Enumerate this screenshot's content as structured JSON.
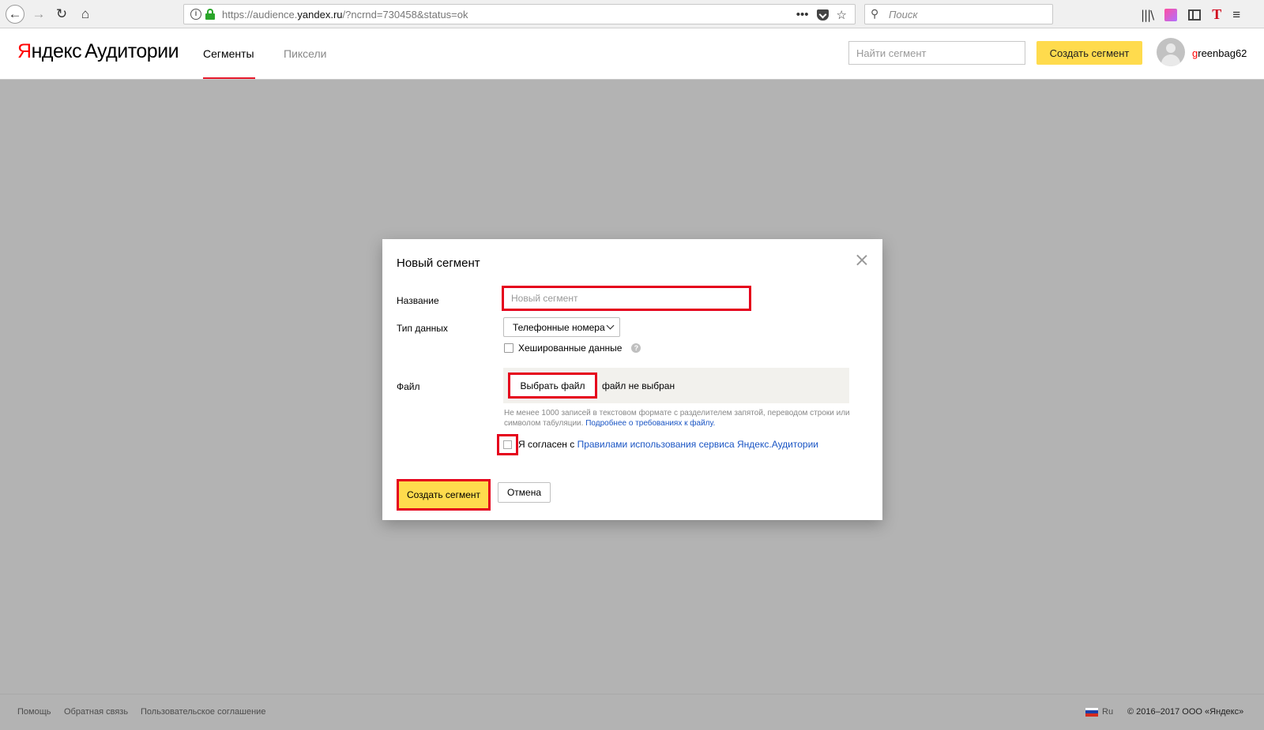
{
  "browser": {
    "url_prefix": "https://audience.",
    "url_host": "yandex.ru",
    "url_suffix": "/?ncrnd=730458&status=ok",
    "more_actions": "•••",
    "bookmark_star": "☆",
    "search_placeholder": "Поиск",
    "icons": {
      "back": "←",
      "forward": "→",
      "reload": "↻",
      "home": "⌂",
      "info": "i",
      "search": "⚲",
      "library": "|||\\",
      "t_addon": "T",
      "menu": "≡"
    }
  },
  "header": {
    "logo_y": "Я",
    "logo_rest": "ндекс",
    "logo_product": "Аудитории",
    "tabs": [
      {
        "label": "Сегменты",
        "active": true
      },
      {
        "label": "Пиксели",
        "active": false
      }
    ],
    "find_placeholder": "Найти сегмент",
    "create_button": "Создать сегмент",
    "username_first": "g",
    "username_rest": "reenbag62"
  },
  "modal": {
    "title": "Новый сегмент",
    "name_label": "Название",
    "name_placeholder": "Новый сегмент",
    "type_label": "Тип данных",
    "type_value": "Телефонные номера",
    "hashed_label": "Хешированные данные",
    "help_icon": "?",
    "file_label": "Файл",
    "choose_file_button": "Выбрать файл",
    "no_file_text": "файл не выбран",
    "hint_text": "Не менее 1000 записей в текстовом формате с разделителем запятой, переводом строки или символом табуляции.",
    "hint_link": "Подробнее о требованиях к файлу.",
    "agree_prefix": "Я согласен с",
    "agree_link": "Правилами использования сервиса Яндекс.Аудитории",
    "create_button": "Создать сегмент",
    "cancel_button": "Отмена"
  },
  "footer": {
    "help": "Помощь",
    "feedback": "Обратная связь",
    "terms": "Пользовательское соглашение",
    "lang": "Ru",
    "copyright": "© 2016–2017 ООО «Яндекс»"
  },
  "colors": {
    "accent_yellow": "#ffdb4d",
    "highlight_red": "#e5001c",
    "link_blue": "#1a55c4",
    "tab_underline": "#e5192c"
  }
}
